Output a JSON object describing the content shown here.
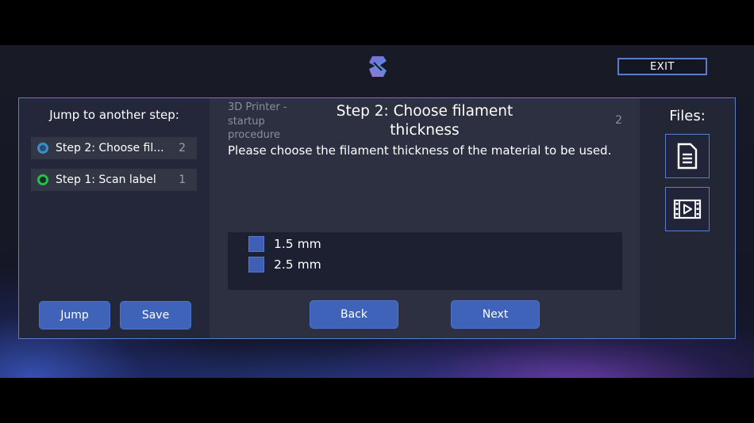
{
  "header": {
    "exit_label": "EXIT",
    "logo_icon": "brand-s-logo-icon"
  },
  "sidebar": {
    "title": "Jump to another step:",
    "steps": [
      {
        "label": "Step 2: Choose fil...",
        "number": "2",
        "status_icon": "status-circle-blue-icon",
        "status_color": "#3a8ed0"
      },
      {
        "label": "Step 1: Scan label",
        "number": "1",
        "status_icon": "status-circle-green-icon",
        "status_color": "#1fc247"
      }
    ],
    "jump_label": "Jump",
    "save_label": "Save"
  },
  "main": {
    "breadcrumb": "3D Printer - startup procedure",
    "step_title": "Step 2: Choose filament thickness",
    "step_index": "2",
    "instructions": "Please choose the filament thickness of the material to be used.",
    "options": [
      {
        "label": "1.5 mm",
        "checked": false
      },
      {
        "label": "2.5 mm",
        "checked": false
      }
    ],
    "back_label": "Back",
    "next_label": "Next"
  },
  "files": {
    "title": "Files:",
    "items": [
      {
        "icon": "document-icon"
      },
      {
        "icon": "video-icon"
      }
    ]
  },
  "colors": {
    "accent_blue": "#3e63b8",
    "frame_border": "#5a7ccc",
    "panel_bg": "#2c3040"
  }
}
